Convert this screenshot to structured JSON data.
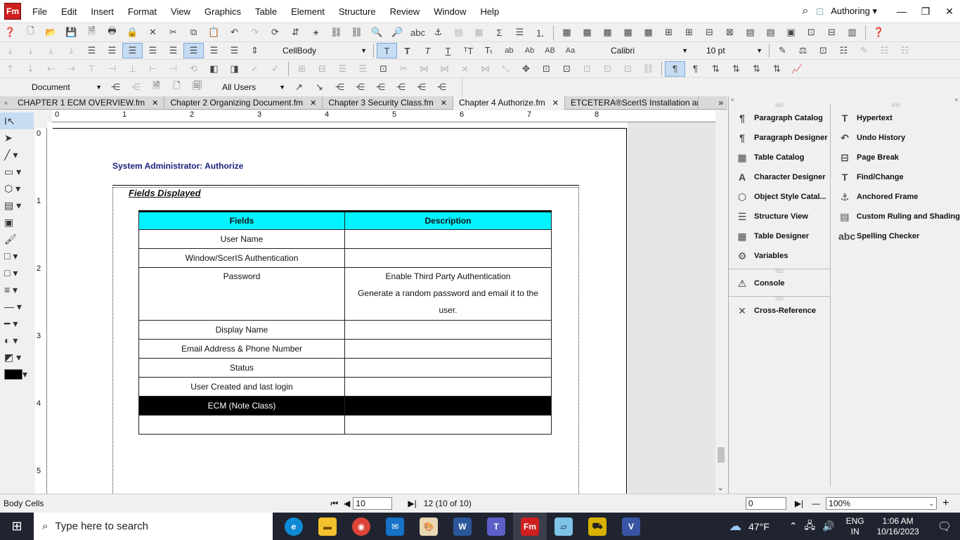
{
  "app": {
    "logo": "Fm",
    "workspace": "Authoring"
  },
  "menu": [
    "File",
    "Edit",
    "Insert",
    "Format",
    "View",
    "Graphics",
    "Table",
    "Element",
    "Structure",
    "Review",
    "Window",
    "Help"
  ],
  "toolbar": {
    "paragraph_style": "CellBody",
    "font_family": "Calibri",
    "font_size": "10 pt",
    "view_mode": "Document",
    "users": "All Users"
  },
  "tabs": [
    {
      "label": "CHAPTER 1 ECM OVERVIEW.fm",
      "active": false
    },
    {
      "label": "Chapter 2 Organizing Document.fm",
      "active": false
    },
    {
      "label": "Chapter 3 Security Class.fm",
      "active": false
    },
    {
      "label": "Chapter 4 Authorize.fm",
      "active": true
    },
    {
      "label": "ETCETERA®ScerIS Installation and C",
      "active": false
    }
  ],
  "ruler": {
    "h": [
      "0",
      "1",
      "2",
      "3",
      "4",
      "5",
      "6",
      "7",
      "8"
    ],
    "v": [
      "0",
      "1",
      "2",
      "3",
      "4",
      "5"
    ]
  },
  "document": {
    "heading": "System Administrator: Authorize",
    "subheading": "Fields Displayed",
    "table": {
      "headers": [
        "Fields",
        "Description"
      ],
      "rows": [
        {
          "field": "User Name",
          "desc": []
        },
        {
          "field": "Window/ScerIS Authentication",
          "desc": []
        },
        {
          "field": "Password",
          "desc": [
            "Enable Third Party Authentication",
            "Generate a random password and email it to the",
            "user."
          ]
        },
        {
          "field": "Display Name",
          "desc": []
        },
        {
          "field": "Email Address & Phone Number",
          "desc": []
        },
        {
          "field": "Status",
          "desc": []
        },
        {
          "field": "User Created and last login",
          "desc": []
        },
        {
          "field": "ECM (Note Class)",
          "desc": [],
          "selected": true
        },
        {
          "field": "",
          "desc": []
        }
      ]
    }
  },
  "panels": {
    "left": [
      "Paragraph Catalog",
      "Paragraph Designer",
      "Table Catalog",
      "Character Designer",
      "Object Style Catal...",
      "Structure View",
      "Table Designer",
      "Variables",
      "Console",
      "Cross-Reference"
    ],
    "right": [
      "Hypertext",
      "Undo History",
      "Page Break",
      "Find/Change",
      "Anchored Frame",
      "Custom Ruling and Shading",
      "Spelling Checker"
    ]
  },
  "status": {
    "context": "Body Cells",
    "page_input": "10",
    "page_info": "12 (10 of 10)",
    "offset_input": "0",
    "zoom": "100%"
  },
  "taskbar": {
    "search_placeholder": "Type here to search",
    "weather": "47°F",
    "lang1": "ENG",
    "lang2": "IN",
    "time": "1:06 AM",
    "date": "10/16/2023"
  }
}
